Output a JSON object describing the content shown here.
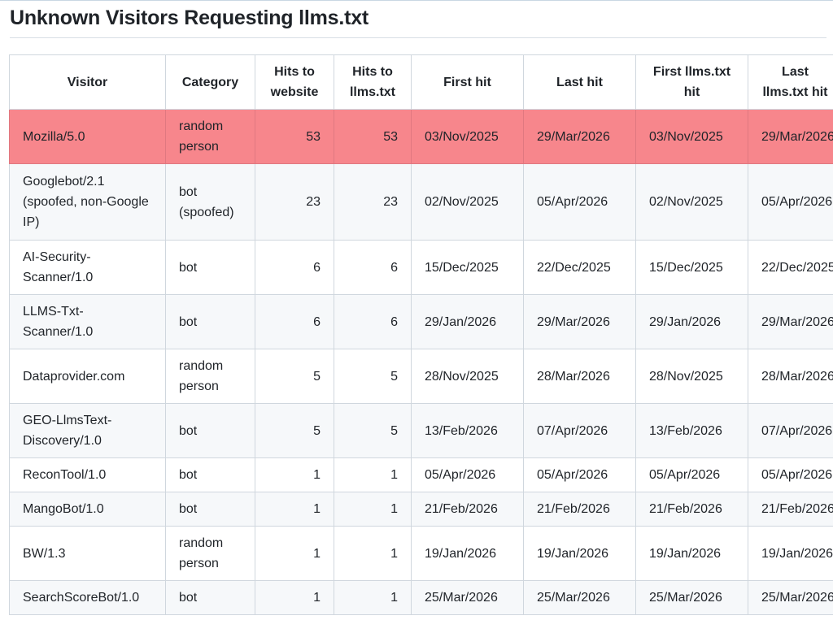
{
  "page": {
    "title": "Unknown Visitors Requesting llms.txt"
  },
  "colors": {
    "highlight_row": "#f7868c",
    "stripe": "#f6f8fa",
    "border": "#d0d7de"
  },
  "table": {
    "headers": {
      "visitor": "Visitor",
      "category": "Category",
      "hits_website": "Hits to website",
      "hits_llms": "Hits to llms.txt",
      "first_hit": "First hit",
      "last_hit": "Last hit",
      "first_llms": "First llms.txt hit",
      "last_llms": "Last llms.txt hit"
    },
    "rows": [
      {
        "visitor": "Mozilla/5.0",
        "category": "random person",
        "hits_website": "53",
        "hits_llms": "53",
        "first_hit": "03/Nov/2025",
        "last_hit": "29/Mar/2026",
        "first_llms": "03/Nov/2025",
        "last_llms": "29/Mar/2026",
        "highlighted": true
      },
      {
        "visitor": "Googlebot/2.1 (spoofed, non-Google IP)",
        "category": "bot (spoofed)",
        "hits_website": "23",
        "hits_llms": "23",
        "first_hit": "02/Nov/2025",
        "last_hit": "05/Apr/2026",
        "first_llms": "02/Nov/2025",
        "last_llms": "05/Apr/2026"
      },
      {
        "visitor": "AI-Security-Scanner/1.0",
        "category": "bot",
        "hits_website": "6",
        "hits_llms": "6",
        "first_hit": "15/Dec/2025",
        "last_hit": "22/Dec/2025",
        "first_llms": "15/Dec/2025",
        "last_llms": "22/Dec/2025"
      },
      {
        "visitor": "LLMS-Txt-Scanner/1.0",
        "category": "bot",
        "hits_website": "6",
        "hits_llms": "6",
        "first_hit": "29/Jan/2026",
        "last_hit": "29/Mar/2026",
        "first_llms": "29/Jan/2026",
        "last_llms": "29/Mar/2026"
      },
      {
        "visitor": "Dataprovider.com",
        "category": "random person",
        "hits_website": "5",
        "hits_llms": "5",
        "first_hit": "28/Nov/2025",
        "last_hit": "28/Mar/2026",
        "first_llms": "28/Nov/2025",
        "last_llms": "28/Mar/2026"
      },
      {
        "visitor": "GEO-LlmsText-Discovery/1.0",
        "category": "bot",
        "hits_website": "5",
        "hits_llms": "5",
        "first_hit": "13/Feb/2026",
        "last_hit": "07/Apr/2026",
        "first_llms": "13/Feb/2026",
        "last_llms": "07/Apr/2026"
      },
      {
        "visitor": "ReconTool/1.0",
        "category": "bot",
        "hits_website": "1",
        "hits_llms": "1",
        "first_hit": "05/Apr/2026",
        "last_hit": "05/Apr/2026",
        "first_llms": "05/Apr/2026",
        "last_llms": "05/Apr/2026"
      },
      {
        "visitor": "MangoBot/1.0",
        "category": "bot",
        "hits_website": "1",
        "hits_llms": "1",
        "first_hit": "21/Feb/2026",
        "last_hit": "21/Feb/2026",
        "first_llms": "21/Feb/2026",
        "last_llms": "21/Feb/2026"
      },
      {
        "visitor": "BW/1.3",
        "category": "random person",
        "hits_website": "1",
        "hits_llms": "1",
        "first_hit": "19/Jan/2026",
        "last_hit": "19/Jan/2026",
        "first_llms": "19/Jan/2026",
        "last_llms": "19/Jan/2026"
      },
      {
        "visitor": "SearchScoreBot/1.0",
        "category": "bot",
        "hits_website": "1",
        "hits_llms": "1",
        "first_hit": "25/Mar/2026",
        "last_hit": "25/Mar/2026",
        "first_llms": "25/Mar/2026",
        "last_llms": "25/Mar/2026"
      }
    ]
  }
}
